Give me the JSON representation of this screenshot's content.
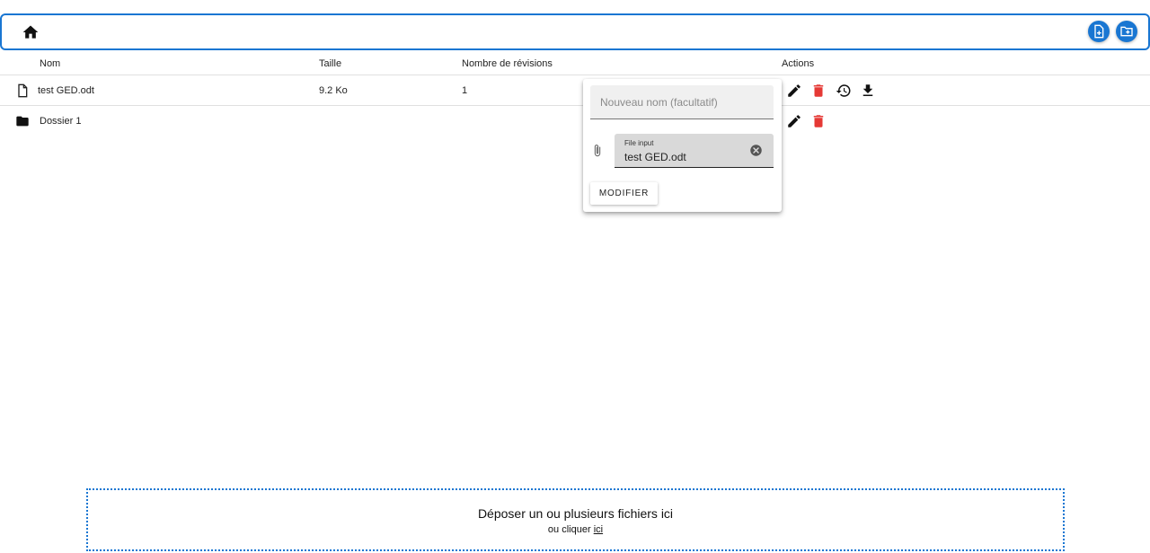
{
  "toolbar": {
    "home_icon": "home-icon",
    "new_file_icon": "file-plus-icon",
    "new_folder_icon": "folder-plus-icon",
    "accent_color": "#1976d2"
  },
  "table": {
    "columns": {
      "name": "Nom",
      "size": "Taille",
      "revisions": "Nombre de révisions",
      "actions": "Actions"
    },
    "rows": [
      {
        "type": "file",
        "name": "test GED.odt",
        "size": "9.2 Ko",
        "revisions": "1"
      },
      {
        "type": "folder",
        "name": "Dossier 1",
        "size": "",
        "revisions": ""
      }
    ]
  },
  "edit_popup": {
    "name_placeholder": "Nouveau nom (facultatif)",
    "file_input_label": "File input",
    "file_input_value": "test GED.odt",
    "submit_label": "MODIFIER"
  },
  "dropzone": {
    "title": "Déposer un ou plusieurs fichiers ici",
    "subtitle_prefix": "ou cliquer",
    "link_label": "ici"
  },
  "colors": {
    "delete": "#e53935",
    "icon": "#222222"
  }
}
